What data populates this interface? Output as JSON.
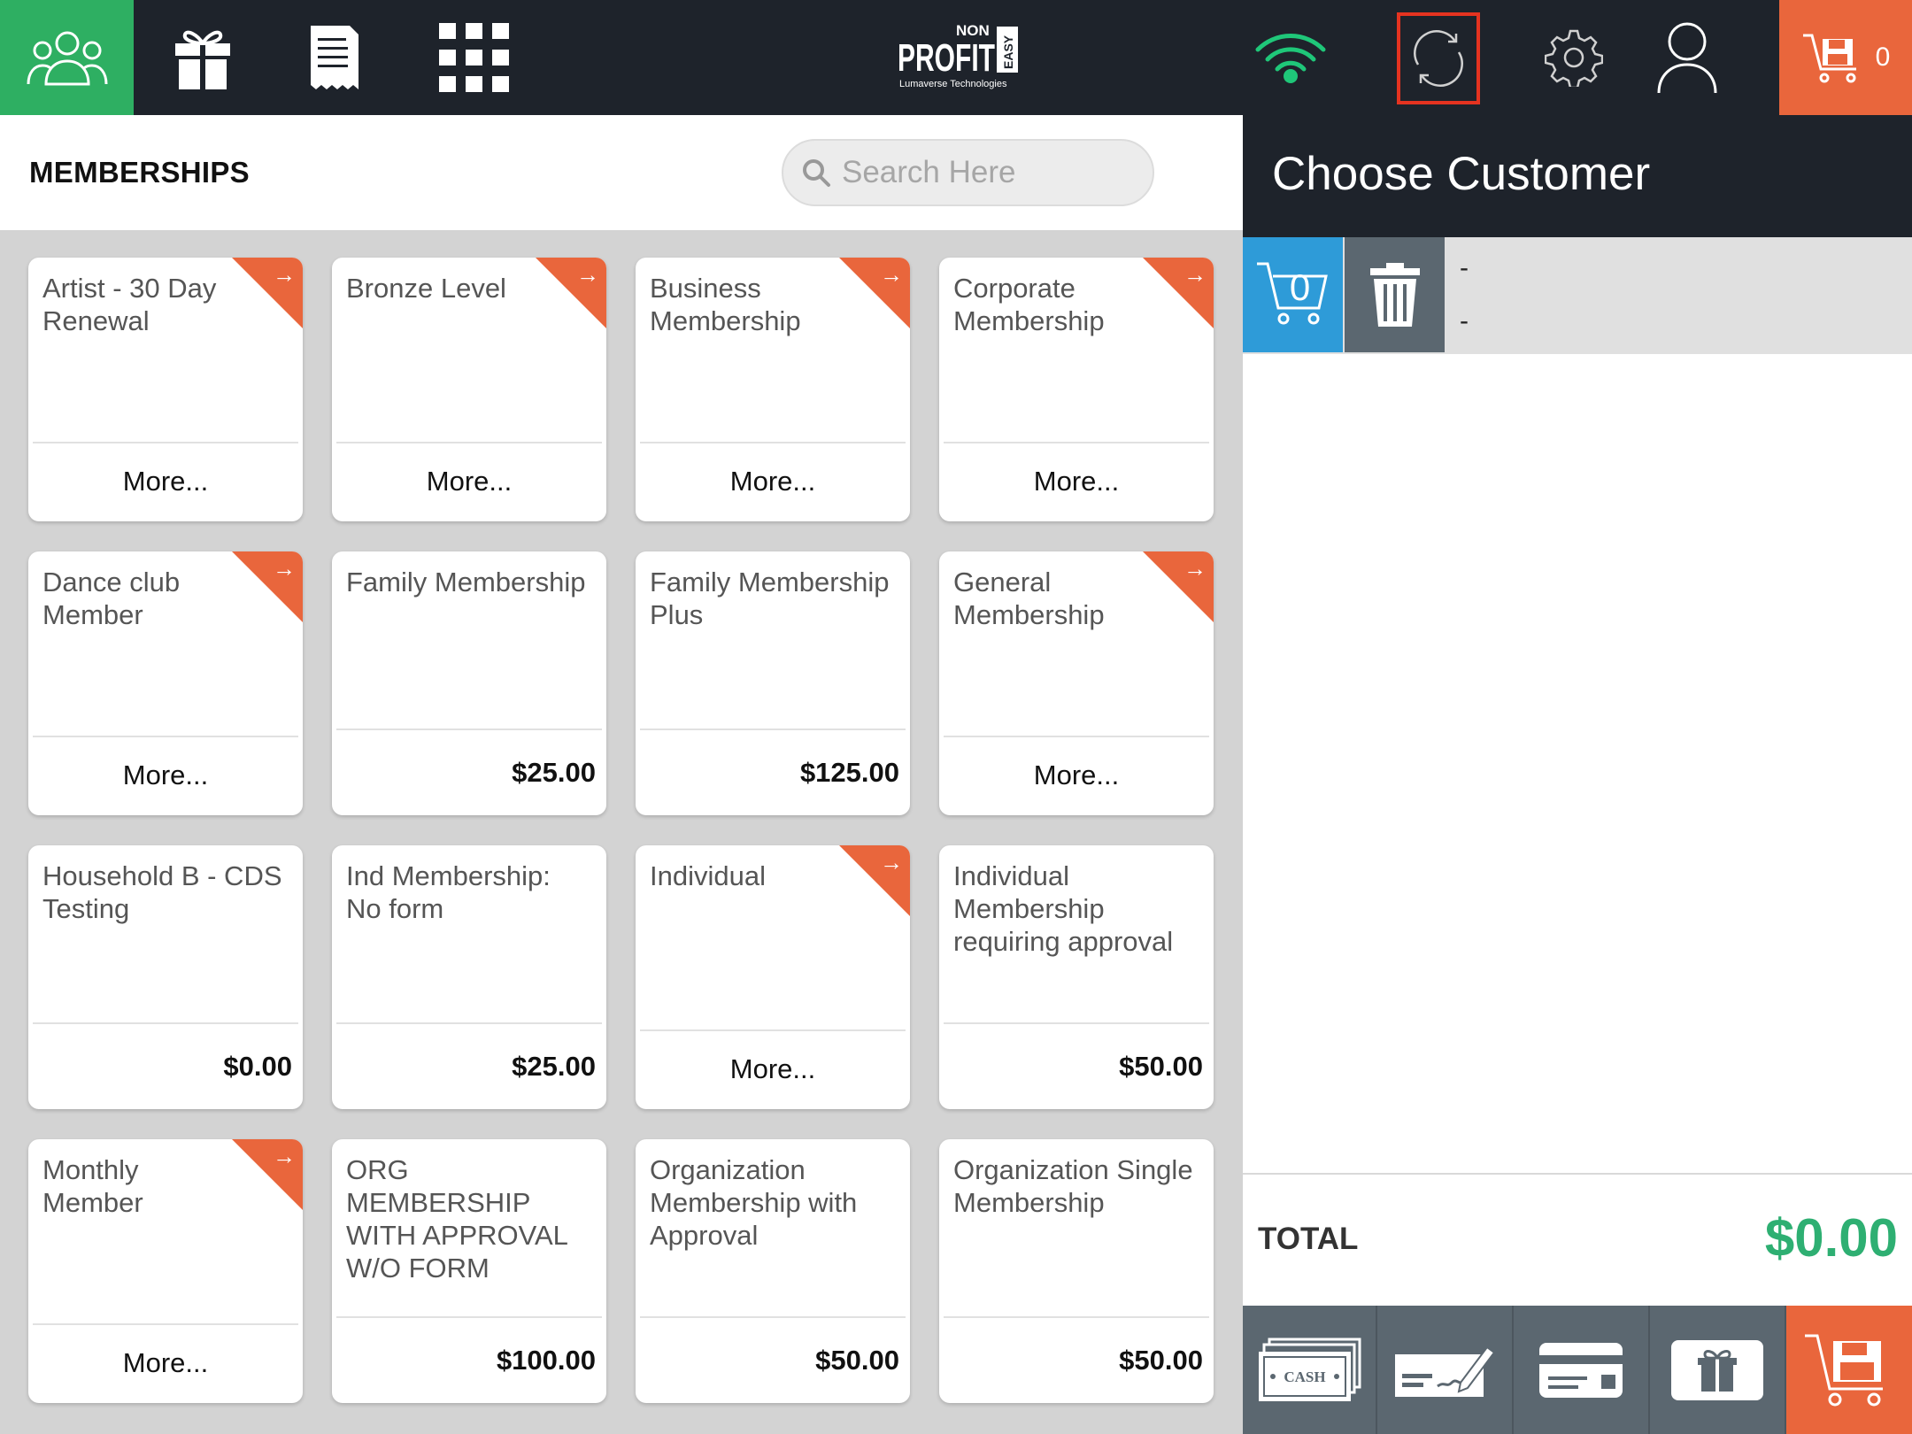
{
  "nav": {
    "items": [
      "people-icon",
      "gift-icon",
      "receipt-icon",
      "grid-icon"
    ],
    "logo": {
      "non": "NON",
      "profit": "PROFIT",
      "easy": "EASY",
      "company": "Lumaverse Technologies"
    },
    "right_items": [
      "wifi-icon",
      "sync-icon",
      "gear-icon",
      "user-icon"
    ],
    "cart_count": "0"
  },
  "colors": {
    "accent_green": "#2eaf62",
    "accent_orange": "#e9663c",
    "dark": "#1e232b",
    "blue": "#2e9bd8",
    "total_green": "#2eaf72"
  },
  "page": {
    "title": "MEMBERSHIPS"
  },
  "search": {
    "placeholder": "Search Here"
  },
  "memberships": [
    {
      "name": "Artist - 30 Day Renewal",
      "footer": "More...",
      "ribbon": true
    },
    {
      "name": "Bronze Level",
      "footer": "More...",
      "ribbon": true
    },
    {
      "name": "Business Membership",
      "footer": "More...",
      "ribbon": true
    },
    {
      "name": "Corporate Membership",
      "footer": "More...",
      "ribbon": true
    },
    {
      "name": "Dance club Member",
      "footer": "More...",
      "ribbon": true
    },
    {
      "name": "Family Membership",
      "footer": "$25.00",
      "ribbon": false
    },
    {
      "name": "Family Membership Plus",
      "footer": "$125.00",
      "ribbon": false
    },
    {
      "name": "General Membership",
      "footer": "More...",
      "ribbon": true
    },
    {
      "name": "Household B - CDS Testing",
      "footer": "$0.00",
      "ribbon": false
    },
    {
      "name": "Ind Membership: No form",
      "footer": "$25.00",
      "ribbon": false
    },
    {
      "name": "Individual",
      "footer": "More...",
      "ribbon": true
    },
    {
      "name": "Individual Membership requiring approval",
      "footer": "$50.00",
      "ribbon": false
    },
    {
      "name": "Monthly Member",
      "footer": "More...",
      "ribbon": true
    },
    {
      "name": "ORG MEMBERSHIP WITH APPROVAL W/O FORM",
      "footer": "$100.00",
      "ribbon": false
    },
    {
      "name": "Organization Membership with Approval",
      "footer": "$50.00",
      "ribbon": false
    },
    {
      "name": "Organization Single Membership",
      "footer": "$50.00",
      "ribbon": false
    }
  ],
  "ribbon_arrow": "→",
  "customer_panel": {
    "title": "Choose Customer",
    "cart_count": "0",
    "line1": "-",
    "line2": "-",
    "total_label": "TOTAL",
    "total_value": "$0.00",
    "payment_buttons": [
      "cash-icon",
      "check-icon",
      "credit-card-icon",
      "gift-card-icon",
      "save-cart-icon"
    ],
    "cash_text": "CASH"
  }
}
